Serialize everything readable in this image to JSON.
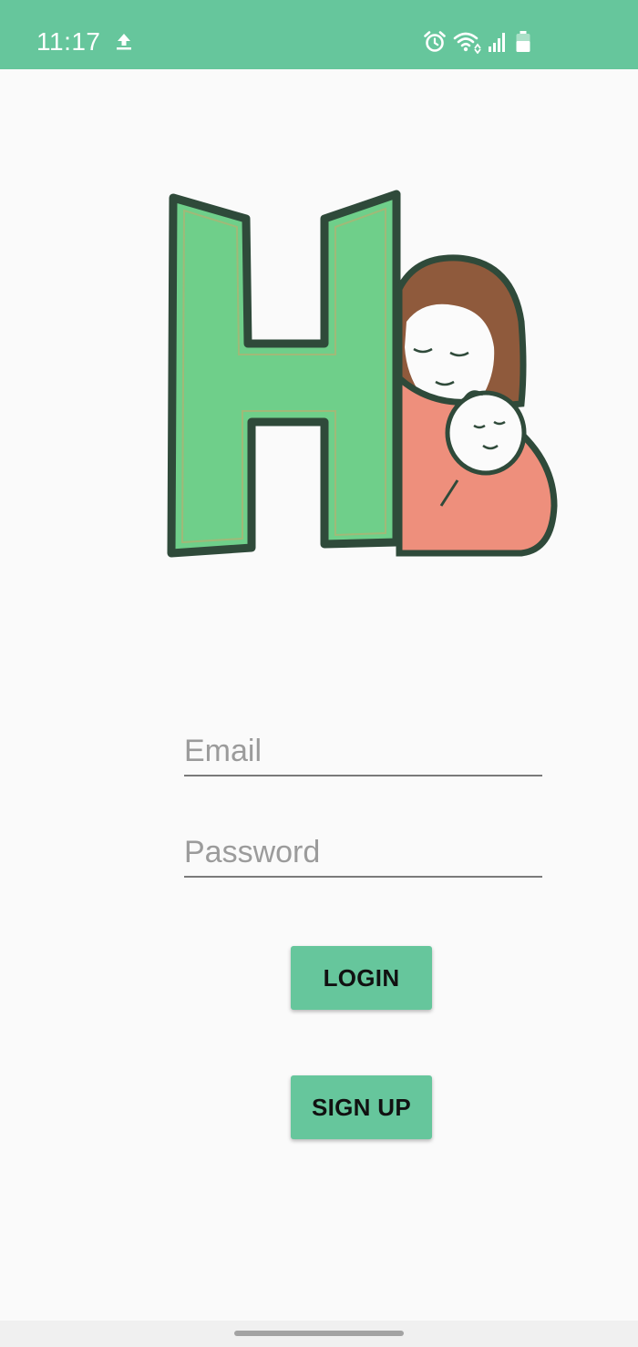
{
  "status_bar": {
    "time": "11:17",
    "icons": [
      "upload-icon",
      "alarm-icon",
      "wifi-icon",
      "signal-icon",
      "battery-icon"
    ],
    "background_color": "#66c69c"
  },
  "logo": {
    "letter": "H",
    "depiction": "mother-and-baby-illustration",
    "letter_color": "#6fcf8a",
    "outline_color": "#2f4a3a",
    "hair_color": "#8f5a3c",
    "clothing_color": "#ee8f7c"
  },
  "form": {
    "email_placeholder": "Email",
    "password_placeholder": "Password",
    "email_value": "",
    "password_value": ""
  },
  "buttons": {
    "login_label": "LOGIN",
    "signup_label": "SIGN UP",
    "color": "#66c69c"
  },
  "nav_bar": {
    "indicator": "home-indicator"
  }
}
